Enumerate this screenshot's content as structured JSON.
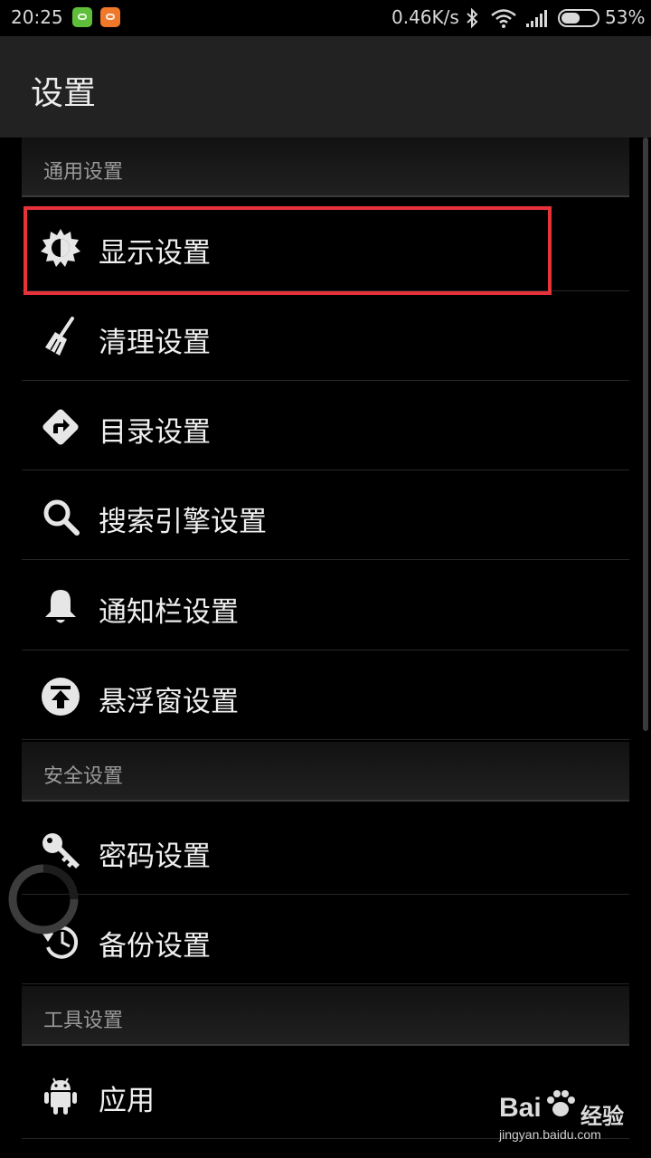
{
  "status_bar": {
    "time": "20:25",
    "net_speed": "0.46K/s",
    "battery": "53%",
    "battery_level": 0.53
  },
  "action_bar": {
    "title": "设置"
  },
  "sections": [
    {
      "label": "通用设置",
      "items": [
        {
          "label": "显示设置",
          "icon": "brightness-icon",
          "highlighted": true
        },
        {
          "label": "清理设置",
          "icon": "broom-icon"
        },
        {
          "label": "目录设置",
          "icon": "directions-icon"
        },
        {
          "label": "搜索引擎设置",
          "icon": "search-icon"
        },
        {
          "label": "通知栏设置",
          "icon": "bell-icon"
        },
        {
          "label": "悬浮窗设置",
          "icon": "upload-icon"
        }
      ]
    },
    {
      "label": "安全设置",
      "items": [
        {
          "label": "密码设置",
          "icon": "key-icon"
        },
        {
          "label": "备份设置",
          "icon": "history-icon"
        }
      ]
    },
    {
      "label": "工具设置",
      "items": [
        {
          "label": "应用",
          "icon": "android-icon"
        }
      ]
    }
  ],
  "watermark": {
    "brand": "Bai",
    "label": "经验",
    "url": "jingyan.baidu.com"
  },
  "colors": {
    "highlight": "#e8323a",
    "background": "#000000",
    "action_bar": "#222222"
  }
}
